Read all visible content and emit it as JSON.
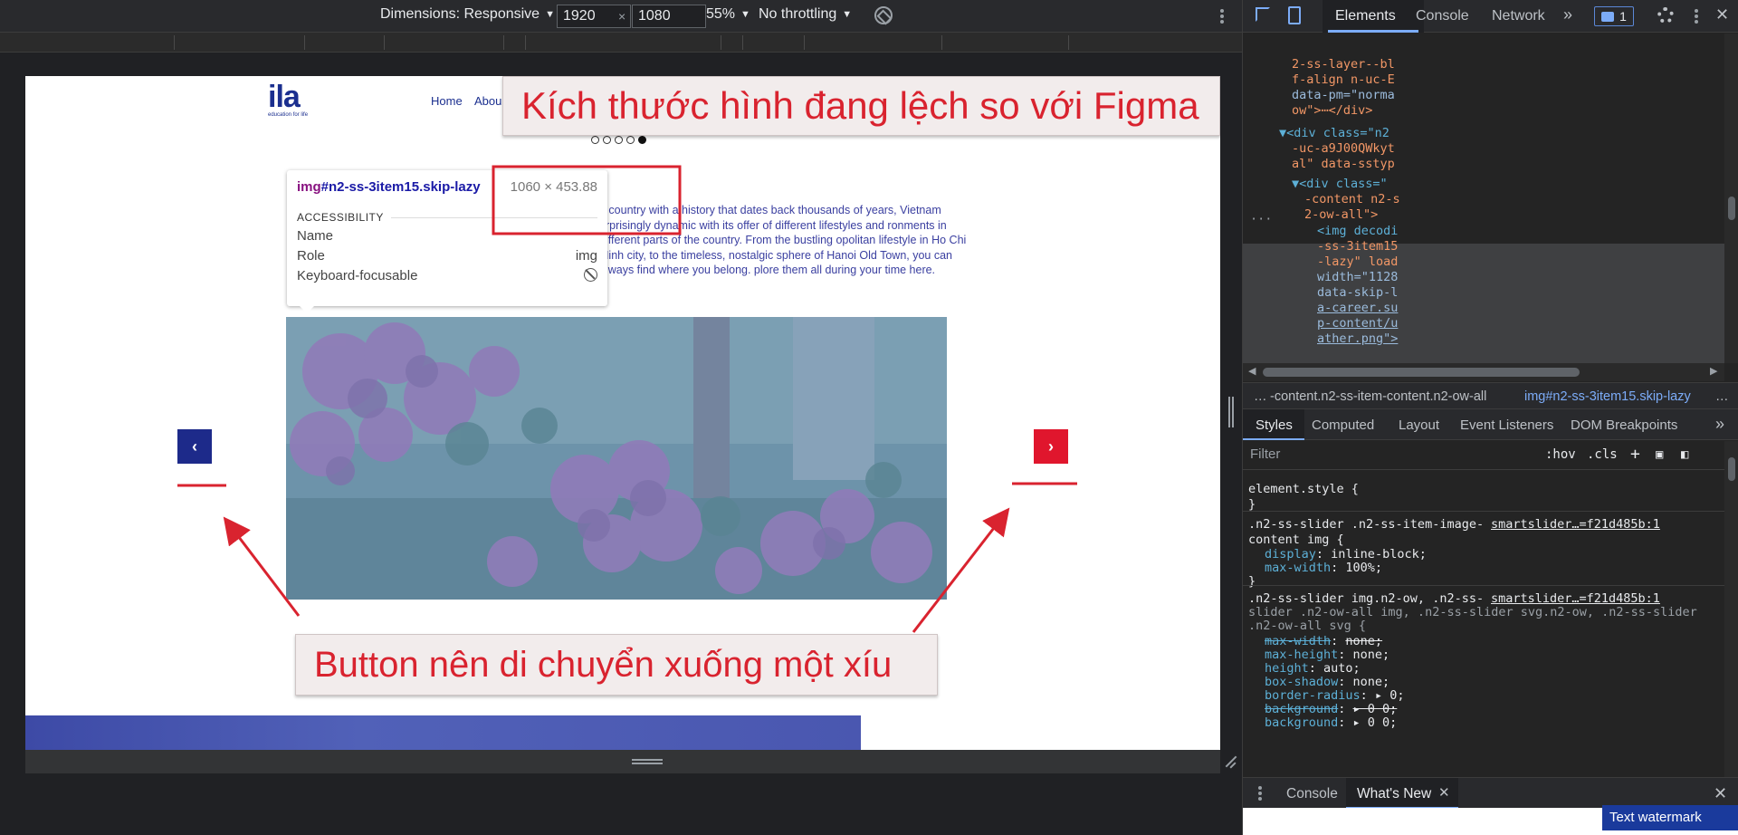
{
  "device_toolbar": {
    "dimensions_label": "Dimensions: Responsive",
    "width_value": "1920",
    "height_value": "1080",
    "zoom": "55%",
    "throttling": "No throttling"
  },
  "site": {
    "logo_text": "ila",
    "logo_subtext": "education for life",
    "nav": {
      "home": "Home",
      "about": "Abou"
    },
    "paragraph": "n country with a history that dates back thousands of years, Vietnam urprisingly dynamic with its offer of different lifestyles and ronments in different parts of the country. From the bustling opolitan lifestyle in Ho Chi Minh city, to the timeless, nostalgic sphere of Hanoi Old Town, you can always find where you belong. plore them all during your time here.",
    "prev_glyph": "‹",
    "next_glyph": "›",
    "slider_dots": 5,
    "active_dot": 5
  },
  "tooltip": {
    "tag": "img",
    "selector": "#n2-ss-3item15.skip-lazy",
    "size": "1060 × 453.88",
    "section": "ACCESSIBILITY",
    "rows": [
      {
        "label": "Name",
        "value": ""
      },
      {
        "label": "Role",
        "value": "img"
      },
      {
        "label": "Keyboard-focusable",
        "value": ""
      }
    ]
  },
  "annotations": {
    "top": "Kích thước hình đang lệch so với Figma",
    "bottom": "Button nên di chuyển xuống một xíu",
    "color": "#d9232f"
  },
  "devtools": {
    "tabs": [
      "Elements",
      "Console",
      "Network"
    ],
    "active_tab": "Elements",
    "message_count": "1",
    "dom_lines": [
      {
        "t": "2-ss-layer--bl",
        "cls": "c-val"
      },
      {
        "t": "f-align n-uc-E",
        "cls": "c-val"
      },
      {
        "t": "data-pm=\"norma",
        "cls": "c-attr"
      },
      {
        "t": "ow\">⋯</div>",
        "cls": "c-val"
      },
      {
        "t": "▼<div class=\"n2",
        "cls": "c-tag"
      },
      {
        "t": "-uc-a9J00QWkyt",
        "cls": "c-val"
      },
      {
        "t": "al\" data-sstyp",
        "cls": "c-val"
      },
      {
        "t": "▼<div class=\"",
        "cls": "c-tag"
      },
      {
        "t": "-content n2-s",
        "cls": "c-val"
      },
      {
        "t": "2-ow-all\">",
        "cls": "c-val"
      },
      {
        "t": "<img decodi",
        "cls": "c-tag"
      },
      {
        "t": "-ss-3item15",
        "cls": "c-val"
      },
      {
        "t": "-lazy\" load",
        "cls": "c-val"
      },
      {
        "t": "width=\"1128",
        "cls": "c-attr"
      },
      {
        "t": "data-skip-l",
        "cls": "c-attr"
      },
      {
        "t": "a-career.su",
        "cls": "c-link"
      },
      {
        "t": "p-content/u",
        "cls": "c-link"
      },
      {
        "t": "ather.png\">",
        "cls": "c-link"
      }
    ],
    "breadcrumb": [
      "…",
      "-content.n2-ss-item-content.n2-ow-all",
      "img#n2-ss-3item15.skip-lazy",
      "…"
    ],
    "style_tabs": [
      "Styles",
      "Computed",
      "Layout",
      "Event Listeners",
      "DOM Breakpoints"
    ],
    "filter_placeholder": "Filter",
    "filter_hov": ":hov",
    "filter_cls": ".cls",
    "styles": {
      "element_style": "element.style {",
      "close": "}",
      "rule1_selector_a": ".n2-ss-slider .n2-ss-item-image-",
      "rule1_selector_b": "content img {",
      "rule1_source": "smartslider…=f21d485b:1",
      "rule1_props": [
        {
          "p": "display",
          "v": "inline-block;"
        },
        {
          "p": "max-width",
          "v": "100%;"
        }
      ],
      "rule2_selector_a": ".n2-ss-slider img.n2-ow, .n2-ss-",
      "rule2_selector_b": "slider .n2-ow-all img, .n2-ss-slider svg.n2-ow, .n2-ss-slider",
      "rule2_selector_c": ".n2-ow-all svg {",
      "rule2_source": "smartslider…=f21d485b:1",
      "rule2_props": [
        {
          "p": "max-width",
          "v": "none;",
          "strike": true
        },
        {
          "p": "max-height",
          "v": "none;"
        },
        {
          "p": "height",
          "v": "auto;"
        },
        {
          "p": "box-shadow",
          "v": "none;"
        },
        {
          "p": "border-radius",
          "v": "▸ 0;"
        },
        {
          "p": "background",
          "v": "▸ 0 0;",
          "strike": true
        },
        {
          "p": "background",
          "v": "▸ 0 0;"
        }
      ]
    },
    "drawer_tabs": [
      "Console",
      "What's New"
    ],
    "drawer_active": "What's New"
  },
  "watermark": "Text watermark"
}
